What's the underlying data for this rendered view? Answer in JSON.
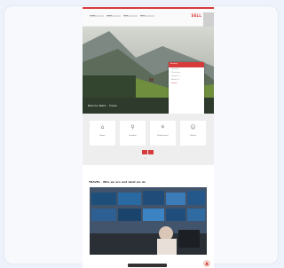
{
  "header": {
    "nav_items": [
      "Lorem",
      "Ipsum",
      "Dolor",
      "Amet",
      "Consec",
      "Elit"
    ],
    "brand": "SELL"
  },
  "hero": {
    "caption": "Nature Walk · Trails"
  },
  "popup": {
    "heading": "Booking",
    "rows": [
      "Check-in",
      "Check-out",
      "Guests: 2",
      "Rooms: 1",
      "Search"
    ]
  },
  "tiles": [
    {
      "icon": "home-icon",
      "glyph": "⌂",
      "label": "Home"
    },
    {
      "icon": "pin-icon",
      "glyph": "⚲",
      "label": "Location"
    },
    {
      "icon": "gift-icon",
      "glyph": "⚘",
      "label": "Experiences"
    },
    {
      "icon": "person-icon",
      "glyph": "☺",
      "label": "Guests"
    }
  ],
  "section": {
    "title": "TRAVEL · Who we are and what we do"
  },
  "colors": {
    "accent": "#d63a3a",
    "page_bg": "#eef3fb"
  }
}
